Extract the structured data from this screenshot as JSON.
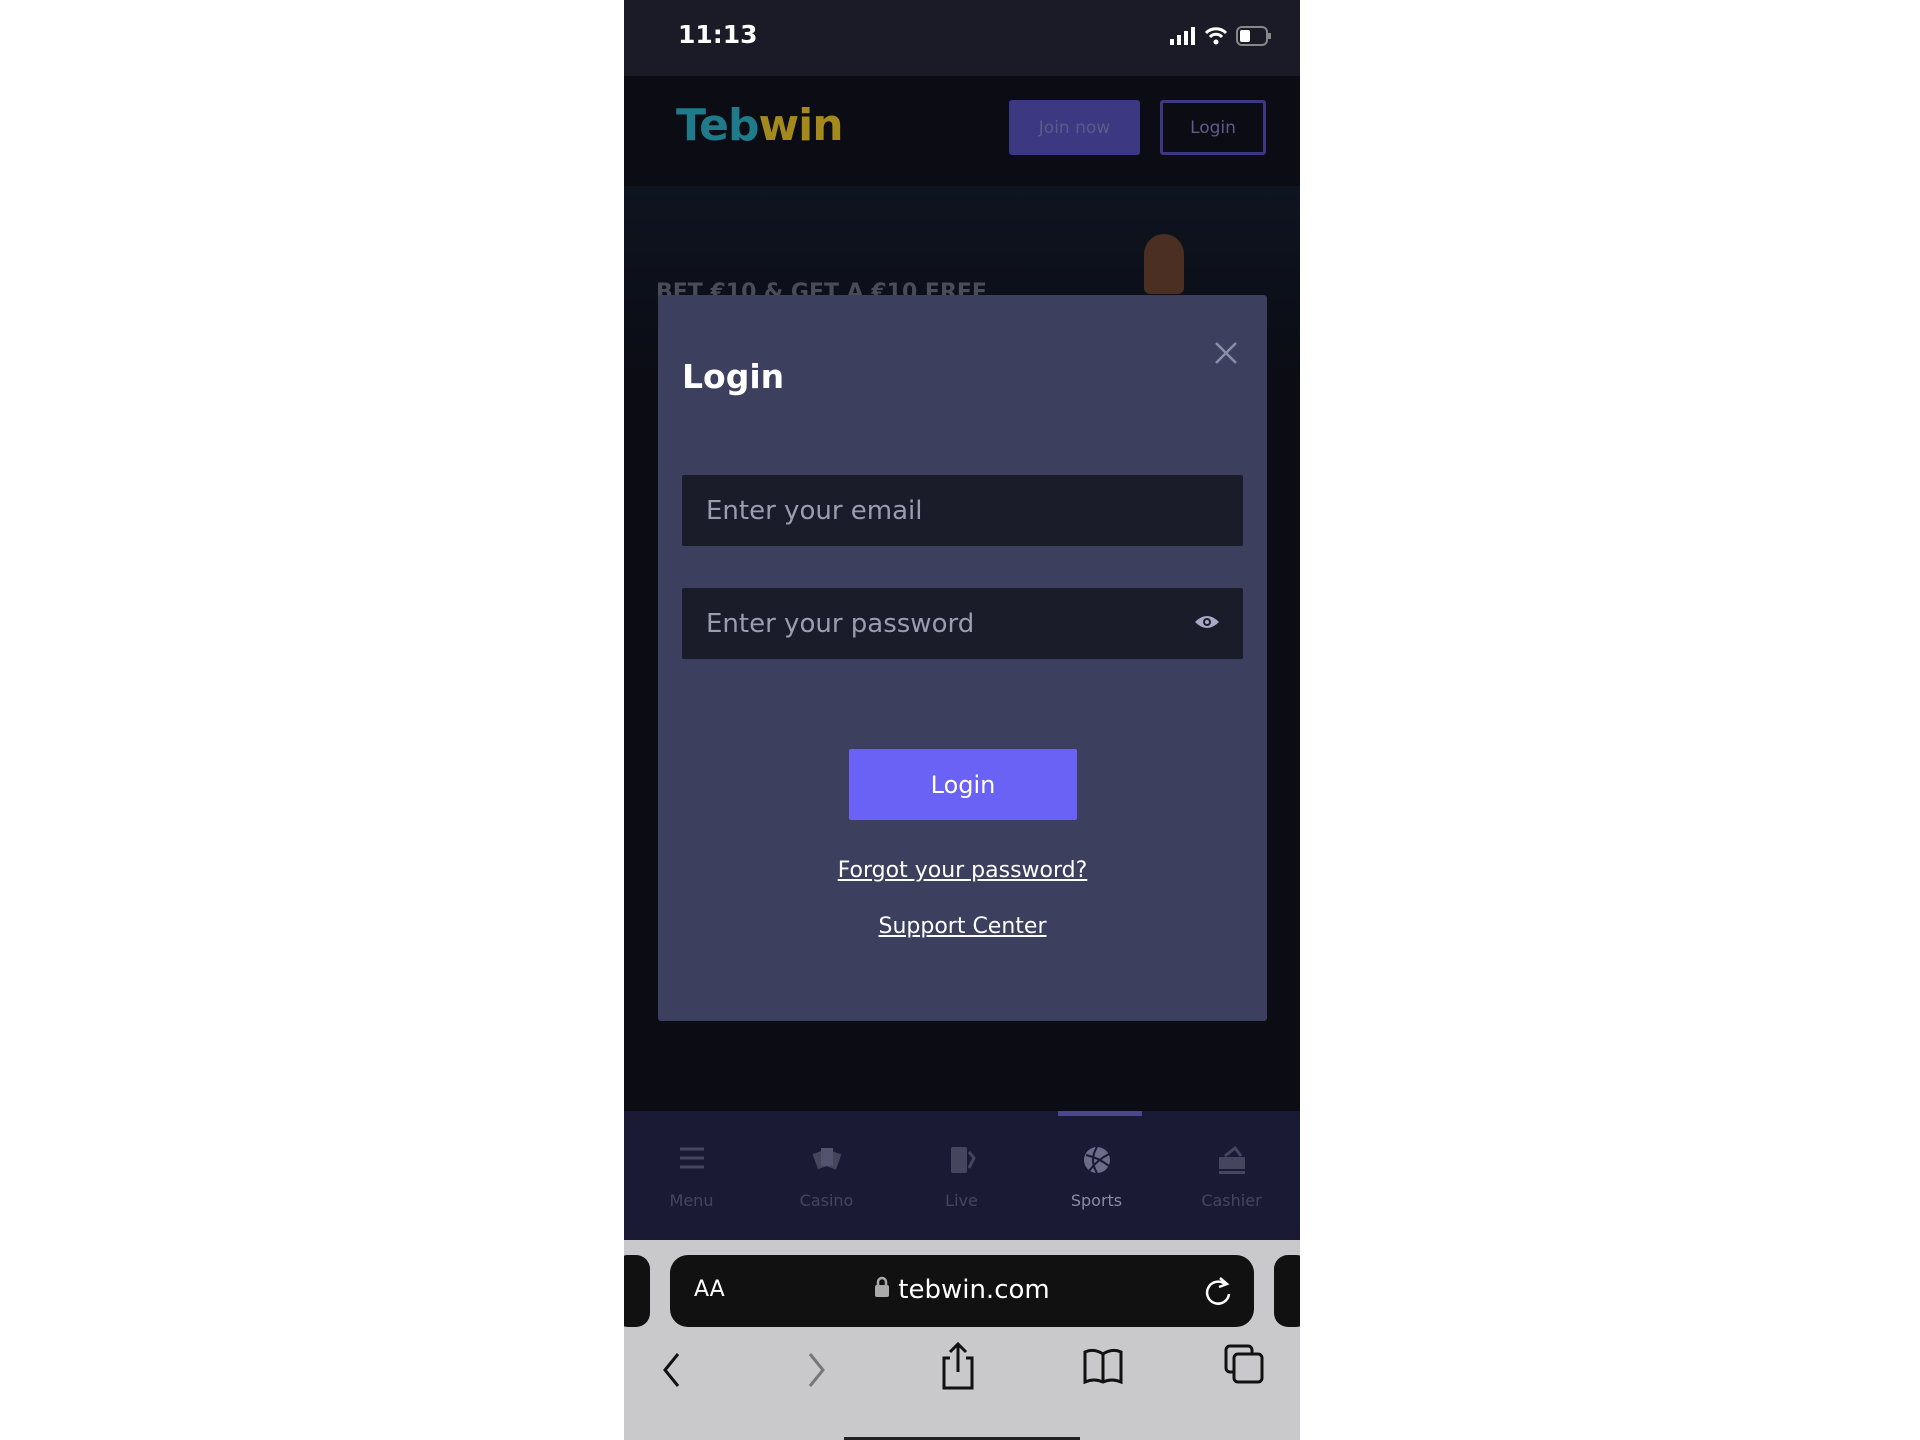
{
  "status": {
    "time": "11:13"
  },
  "header": {
    "logo_part1": "Teb",
    "logo_part2": "win",
    "join_label": "Join now",
    "login_label": "Login"
  },
  "banner": {
    "promo": "BET €10 & GET A €10 FREE"
  },
  "modal": {
    "title": "Login",
    "email_placeholder": "Enter your email",
    "password_placeholder": "Enter your password",
    "login_label": "Login",
    "forgot_label": "Forgot your password?",
    "support_label": "Support Center"
  },
  "tabbar": {
    "items": [
      {
        "label": "Menu",
        "icon": "menu-icon"
      },
      {
        "label": "Casino",
        "icon": "cards-icon"
      },
      {
        "label": "Live",
        "icon": "live-cards-icon"
      },
      {
        "label": "Sports",
        "icon": "ball-icon",
        "active": true
      },
      {
        "label": "Cashier",
        "icon": "wallet-icon"
      }
    ]
  },
  "browser": {
    "aa": "AA",
    "url": "tebwin.com"
  },
  "colors": {
    "accent": "#6a62f4",
    "modal_bg": "#3d3f5e",
    "input_bg": "#1b1c2a"
  }
}
